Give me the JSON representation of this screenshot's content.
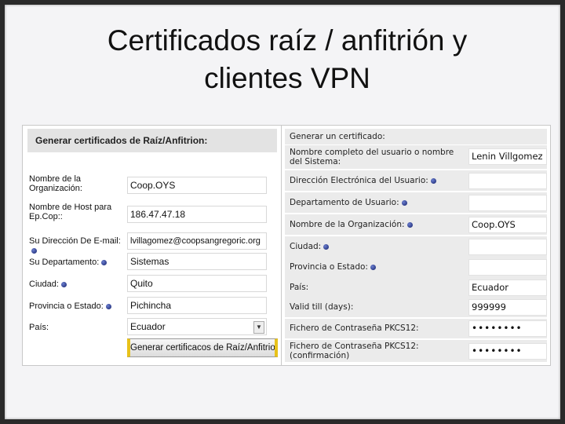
{
  "slide": {
    "title_line1": "Certificados raíz / anfitrión y",
    "title_line2": "clientes VPN"
  },
  "left_form": {
    "header": "Generar certificados de Raíz/Anfitrion:",
    "fields": [
      {
        "label": "Nombre de la Organización:",
        "value": "Coop.OYS",
        "required": false
      },
      {
        "label": "Nombre de Host para Ep.Cop::",
        "value": "186.47.47.18",
        "required": false
      },
      {
        "label": "Su Dirección De E-mail:",
        "value": "lvillagomez@coopsangregoric.org",
        "required": true
      },
      {
        "label": "Su Departamento:",
        "value": "Sistemas",
        "required": true
      },
      {
        "label": "Ciudad:",
        "value": "Quito",
        "required": true
      },
      {
        "label": "Provincia o Estado:",
        "value": "Pichincha",
        "required": true
      }
    ],
    "country_label": "País:",
    "country_value": "Ecuador",
    "submit_label": "Generar certificacos de Raíz/Anfitrion"
  },
  "right_form": {
    "header": "Generar un certificado:",
    "fields": [
      {
        "label": "Nombre completo del usuario o nombre del Sistema:",
        "value": "Lenin Villgomez",
        "required": false
      },
      {
        "label": "Dirección Electrónica del Usuario:",
        "value": "",
        "required": true
      },
      {
        "label": "Departamento de Usuario:",
        "value": "",
        "required": true
      },
      {
        "label": "Nombre de la Organización:",
        "value": "Coop.OYS",
        "required": true
      },
      {
        "label": "Ciudad:",
        "value": "",
        "required": true
      },
      {
        "label": "Provincia o Estado:",
        "value": "",
        "required": true
      },
      {
        "label": "País:",
        "value": "Ecuador",
        "required": false
      },
      {
        "label": "Valid till (days):",
        "value": "999999",
        "required": false
      },
      {
        "label": "Fichero de Contraseña PKCS12:",
        "value": "••••••••",
        "required": false
      },
      {
        "label": "Fichero de Contraseña PKCS12: (confirmación)",
        "value": "••••••••",
        "required": false
      }
    ]
  },
  "colors": {
    "bullet": "#1a2a80",
    "button_accent": "#e8c21a",
    "frame": "#2a2a2a",
    "slide_bg": "#f4f4f6"
  }
}
